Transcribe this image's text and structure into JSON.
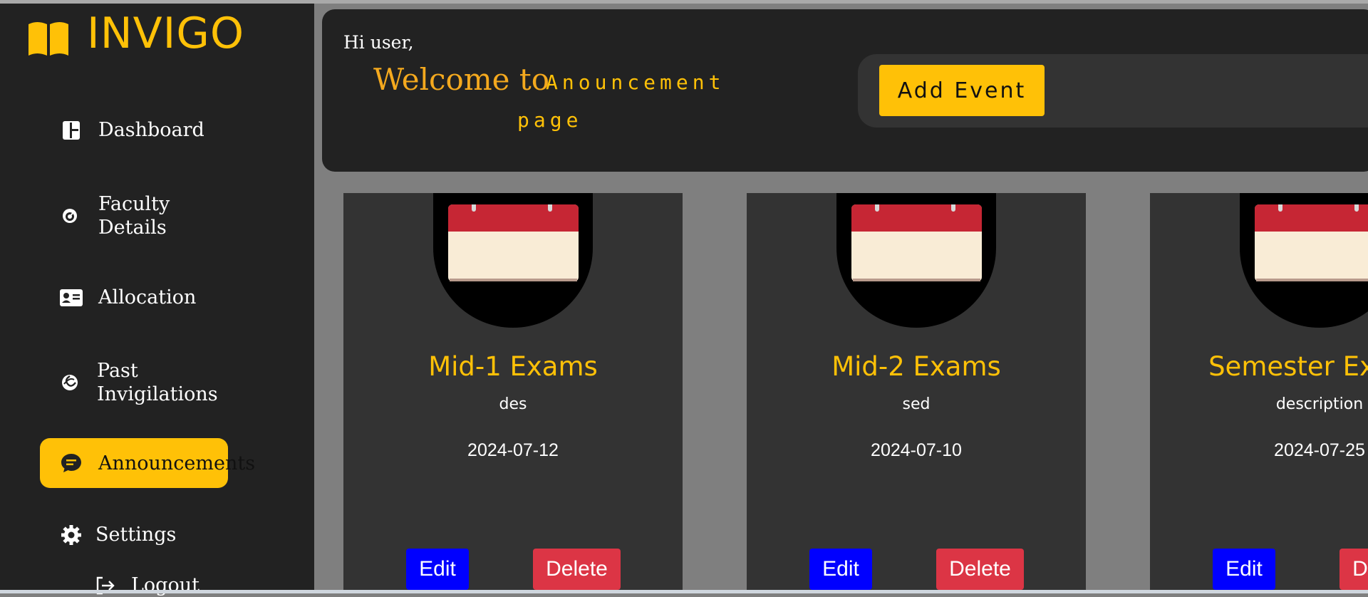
{
  "app": {
    "brand": "INVIGO",
    "accent": "#ffc107"
  },
  "sidebar": {
    "items": [
      {
        "label": "Dashboard",
        "icon": "dashboard-icon",
        "active": false
      },
      {
        "label": "Faculty Details",
        "icon": "gauge-icon",
        "active": false
      },
      {
        "label": "Allocation",
        "icon": "id-card-icon",
        "active": false
      },
      {
        "label": "Past Invigilations",
        "icon": "spiral-icon",
        "active": false
      },
      {
        "label": "Announcements",
        "icon": "chat-bubble-icon",
        "active": true
      },
      {
        "label": "Settings",
        "icon": "gear-icon",
        "active": false
      }
    ],
    "logout": "Logout"
  },
  "header": {
    "greeting": "Hi user,",
    "welcome": "Welcome to",
    "page_line1": "Anouncement",
    "page_line2": "page",
    "add_event_label": "Add Event"
  },
  "cards": [
    {
      "title": "Mid-1 Exams",
      "description": "des",
      "date": "2024-07-12",
      "edit": "Edit",
      "delete": "Delete"
    },
    {
      "title": "Mid-2 Exams",
      "description": "sed",
      "date": "2024-07-10",
      "edit": "Edit",
      "delete": "Delete"
    },
    {
      "title": "Semester Exams",
      "description": "description",
      "date": "2024-07-25",
      "edit": "Edit",
      "delete": "Delete"
    }
  ]
}
